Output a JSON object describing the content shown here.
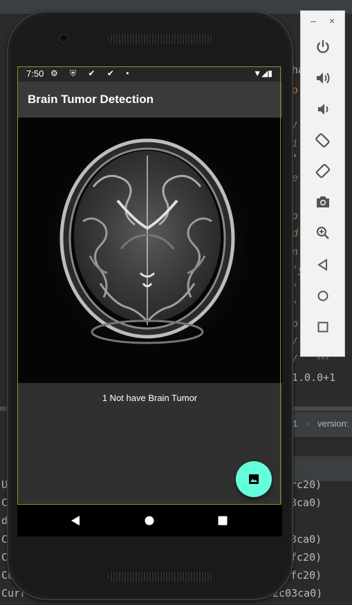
{
  "ide": {
    "code_lines": [
      {
        "text": "ha",
        "style": "plain"
      },
      {
        "text": "o",
        "style": "orange"
      },
      {
        "text": "/ i",
        "style": "green"
      },
      {
        "text": "i p",
        "style": "green"
      },
      {
        "text": "' '",
        "style": "plain"
      },
      {
        "text": "e",
        "style": "green"
      },
      {
        "text": "o r",
        "style": "green"
      },
      {
        "text": "d o",
        "style": "green"
      },
      {
        "text": "n",
        "style": "green"
      },
      {
        "text": "'y",
        "style": "green"
      },
      {
        "text": "' l",
        "style": "green"
      },
      {
        "text": "'",
        "style": "green"
      },
      {
        "text": "o",
        "style": "green"
      },
      {
        "text": "/",
        "style": "green"
      },
      {
        "text": "/",
        "style": "green"
      }
    ],
    "version_text": "1.0.0+1",
    "breadcrumb_num": "1",
    "breadcrumb_label": "version:",
    "console_lines": [
      {
        "left": "U",
        "right": "rc20)"
      },
      {
        "left": "C",
        "right": "3ca0)"
      },
      {
        "left": "d",
        "right": ""
      },
      {
        "left": "C",
        "right": "3ca0)"
      },
      {
        "left": "C",
        "right": "fc20)"
      },
      {
        "left": "Cu",
        "right": "fc20)"
      },
      {
        "left": "Curr",
        "right": "02c03ca0)"
      }
    ]
  },
  "emulator": {
    "minimize_label": "–",
    "close_label": "×",
    "buttons": [
      "power-icon",
      "volume-up-icon",
      "volume-down-icon",
      "rotate-left-icon",
      "rotate-right-icon",
      "camera-icon",
      "zoom-icon",
      "back-icon",
      "home-icon",
      "overview-icon",
      "more-icon"
    ]
  },
  "status_bar": {
    "time": "7:50",
    "left_icons": "⚙ ⛨ ✔ ✔ •",
    "right_icons": "▼◢▮"
  },
  "app": {
    "title": "Brain Tumor Detection",
    "result_text": "1 Not have Brain Tumor",
    "fab_icon": "image-icon",
    "accent_color": "#64ffda"
  },
  "nav": {
    "back": "back-icon",
    "home": "home-icon",
    "recents": "recents-icon"
  }
}
